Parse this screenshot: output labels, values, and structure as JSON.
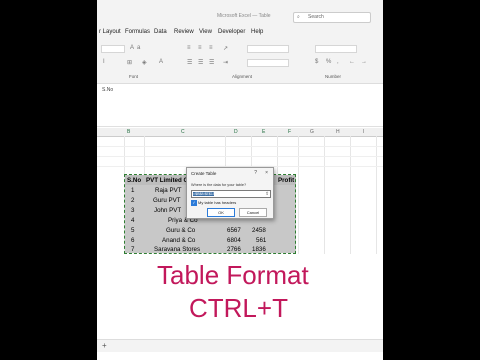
{
  "window": {
    "title": "Microsoft Excel — Table",
    "search_placeholder": "Search"
  },
  "ribbon_tabs": [
    "r Layout",
    "Formulas",
    "Data",
    "Review",
    "View",
    "Developer",
    "Help"
  ],
  "ribbon_groups": {
    "font": "Font",
    "alignment": "Alignment",
    "number": "Number"
  },
  "formula_bar": {
    "value": "S.No"
  },
  "columns": [
    "B",
    "C",
    "D",
    "E",
    "F",
    "G",
    "H",
    "I"
  ],
  "table": {
    "headers": [
      "S.No",
      "PVT Limited Company",
      "Sales",
      "Profit"
    ],
    "header_visible": {
      "sno": "S.No",
      "company": "PVT Limited C",
      "sales": "es",
      "profit": "Profit"
    },
    "rows": [
      {
        "sno": "1",
        "company": "Raja PVT",
        "sales": "",
        "profit": ""
      },
      {
        "sno": "2",
        "company": "Guru PVT",
        "sales": "",
        "profit": ""
      },
      {
        "sno": "3",
        "company": "John PVT",
        "sales": "",
        "profit": ""
      },
      {
        "sno": "4",
        "company": "Priya & Co",
        "sales": "",
        "profit": ""
      },
      {
        "sno": "5",
        "company": "Guru & Co",
        "sales": "6567",
        "profit": "2458"
      },
      {
        "sno": "6",
        "company": "Anand & Co",
        "sales": "6804",
        "profit": "561"
      },
      {
        "sno": "7",
        "company": "Saravana Stores",
        "sales": "2766",
        "profit": "1836"
      }
    ]
  },
  "dialog": {
    "title": "Create Table",
    "help": "?",
    "close": "×",
    "prompt": "Where is the data for your table?",
    "range": "=$B$8:$E$15",
    "range_button": "⇪",
    "checkbox_label": "My table has headers",
    "checkbox_checked": true,
    "ok_label": "OK",
    "cancel_label": "Cancel"
  },
  "overlay": {
    "line1": "Table Format",
    "line2": "CTRL+T",
    "color": "#c2185b"
  },
  "sheet_bar": {
    "add_label": "+"
  },
  "icons": {
    "search": "search-icon",
    "bold": "bold-icon",
    "italic": "italic-icon",
    "underline": "underline-icon"
  }
}
